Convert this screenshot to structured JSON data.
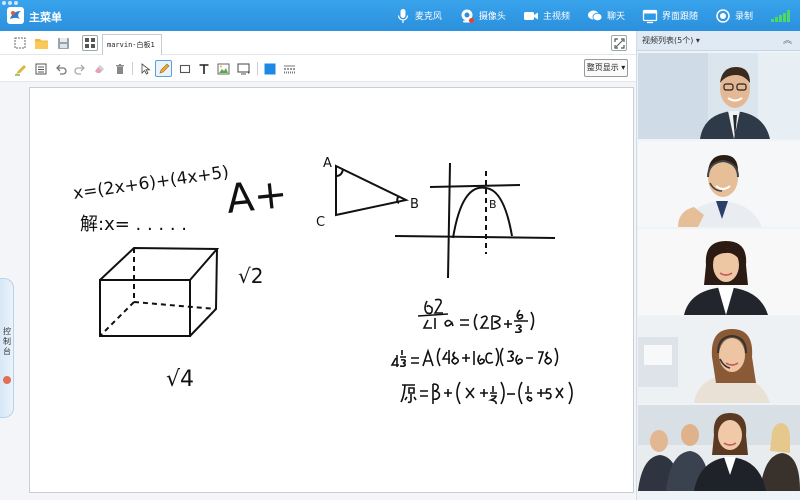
{
  "titlebar": {
    "menu_label": "主菜单",
    "items": [
      {
        "label": "麦克风",
        "icon": "microphone-icon"
      },
      {
        "label": "摄像头",
        "icon": "camera-icon"
      },
      {
        "label": "主视频",
        "icon": "main-video-icon"
      },
      {
        "label": "聊天",
        "icon": "chat-icon"
      },
      {
        "label": "界面跟随",
        "icon": "follow-ui-icon"
      },
      {
        "label": "录制",
        "icon": "record-icon"
      }
    ],
    "signal_color": "#4cd964"
  },
  "tabs": {
    "active_tab": "marvin-白板1"
  },
  "toolbar": {
    "page_display_label": "整页显示",
    "accent_color": "#1e88e5"
  },
  "console": {
    "label": "控制台"
  },
  "video_panel": {
    "title": "视频列表(5个)",
    "participant_count": 5
  },
  "whiteboard": {
    "lines": [
      "x=(2x+6)+(4x+5)",
      "解:x= . . . . .",
      "A+",
      "√2",
      "√4",
      "A",
      "B",
      "C",
      "B"
    ]
  }
}
